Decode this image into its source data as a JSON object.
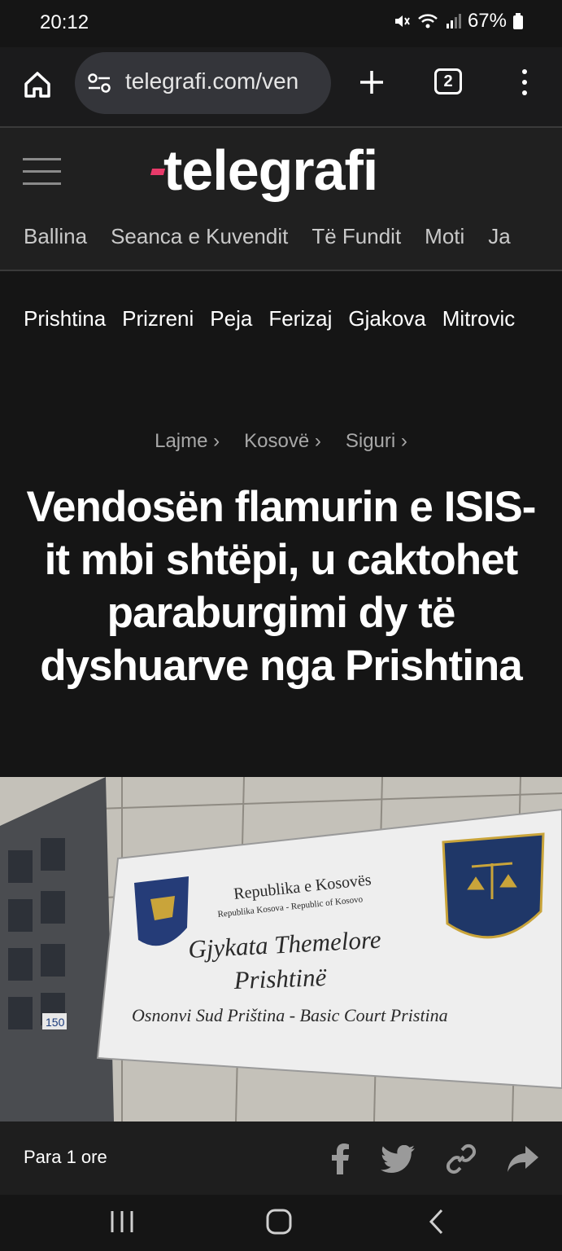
{
  "status": {
    "time": "20:12",
    "battery": "67%"
  },
  "browser": {
    "url": "telegrafi.com/ven",
    "tab_count": "2"
  },
  "site": {
    "logo_text": "telegrafi",
    "main_nav": [
      "Ballina",
      "Seanca e Kuvendit",
      "Të Fundit",
      "Moti",
      "Ja"
    ],
    "city_nav": [
      "Prishtina",
      "Prizreni",
      "Peja",
      "Ferizaj",
      "Gjakova",
      "Mitrovic"
    ]
  },
  "article": {
    "breadcrumb": [
      "Lajme ›",
      "Kosovë ›",
      "Siguri ›"
    ],
    "headline": "Vendosën flamurin e ISIS-it mbi shtëpi, u caktohet paraburgimi dy të dyshuarve nga Prishtina",
    "image_sign": {
      "line1": "Republika e Kosovës",
      "line2": "Republika Kosova - Republic of Kosovo",
      "title1": "Gjykata Themelore",
      "title2": "Prishtinë",
      "subtitle": "Osnonvi Sud Priština - Basic Court Pristina",
      "plate": "150"
    },
    "time_ago": "Para 1 ore"
  },
  "colors": {
    "accent": "#e83a6a",
    "background": "#151515",
    "header": "#202020"
  }
}
